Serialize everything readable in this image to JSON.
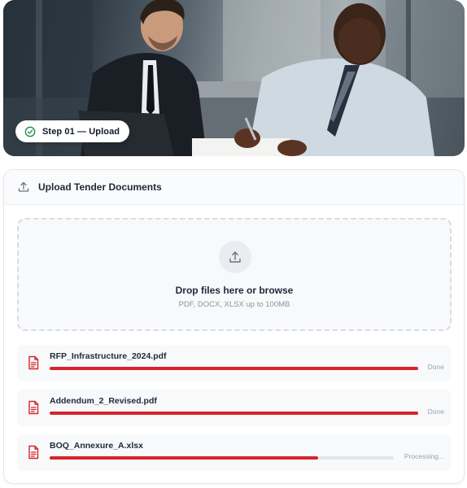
{
  "hero": {
    "step_label": "Step 01 — Upload",
    "step_icon": "check-circle-icon",
    "accent_color": "#1a8a4f"
  },
  "card": {
    "title": "Upload Tender Documents",
    "title_icon": "upload-icon"
  },
  "dropzone": {
    "icon": "upload-icon",
    "title": "Drop files here or browse",
    "subtitle": "PDF, DOCX, XLSX up to 100MB"
  },
  "files": [
    {
      "name": "RFP_Infrastructure_2024.pdf",
      "status": "Done",
      "progress": 1.0,
      "icon": "document-icon"
    },
    {
      "name": "Addendum_2_Revised.pdf",
      "status": "Done",
      "progress": 1.0,
      "icon": "document-icon"
    },
    {
      "name": "BOQ_Annexure_A.xlsx",
      "status": "Processing...",
      "progress": 0.78,
      "icon": "document-icon"
    }
  ],
  "colors": {
    "progress": "#d8232a",
    "file_icon": "#d8232a"
  }
}
